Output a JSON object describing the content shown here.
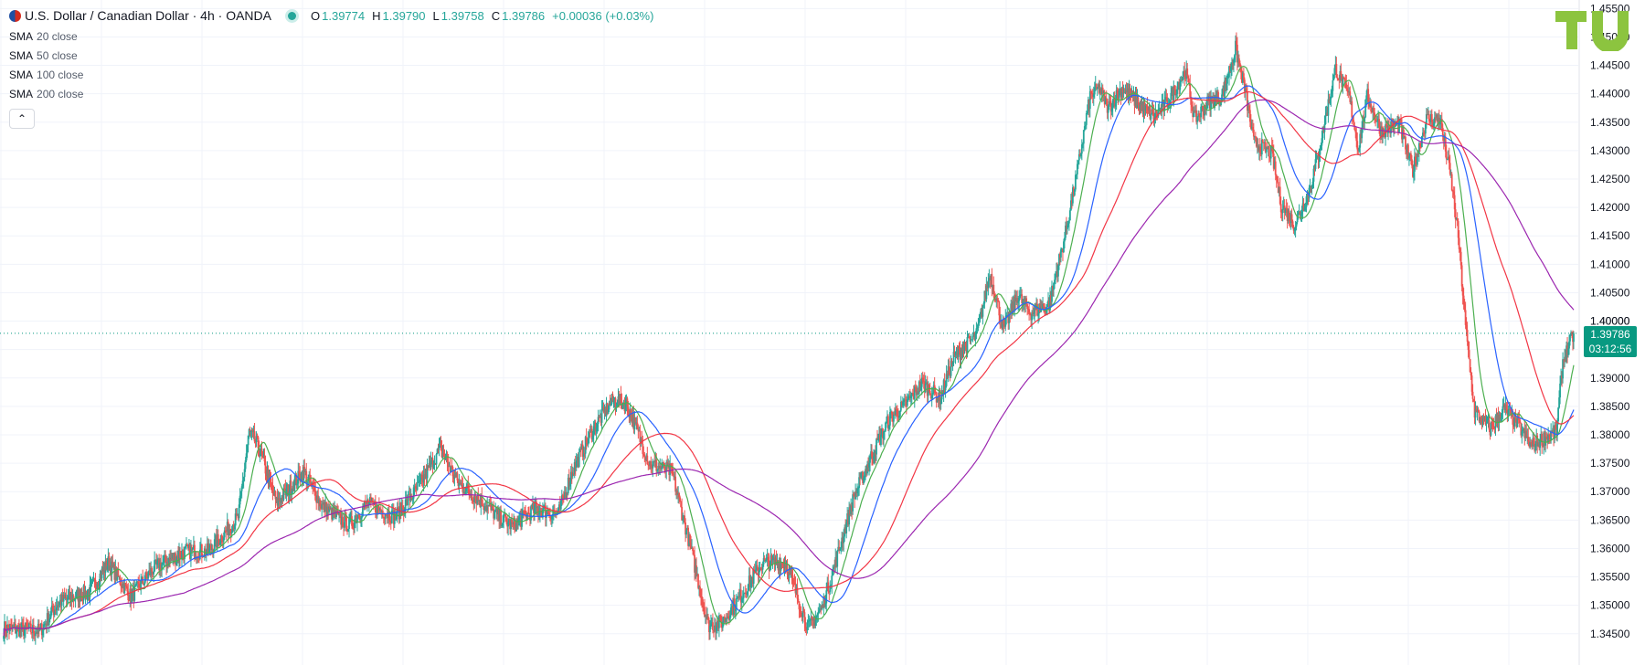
{
  "header": {
    "symbol_title": "U.S. Dollar / Canadian Dollar · 4h · OANDA",
    "ohlc": [
      {
        "key": "O",
        "value": "1.39774"
      },
      {
        "key": "H",
        "value": "1.39790"
      },
      {
        "key": "L",
        "value": "1.39758"
      },
      {
        "key": "C",
        "value": "1.39786"
      }
    ],
    "change": "+0.00036 (+0.03%)"
  },
  "indicators": [
    {
      "name": "SMA",
      "params": "20 close",
      "color": "#4caf50"
    },
    {
      "name": "SMA",
      "params": "50 close",
      "color": "#2962ff"
    },
    {
      "name": "SMA",
      "params": "100 close",
      "color": "#f23645"
    },
    {
      "name": "SMA",
      "params": "200 close",
      "color": "#9c27b0"
    }
  ],
  "last_price": {
    "price": "1.39786",
    "countdown": "03:12:56",
    "color": "#089981"
  },
  "colors": {
    "up": "#26a69a",
    "down": "#ef5350",
    "grid": "#f0f3fa",
    "axis_text": "#131722"
  },
  "chart_data": {
    "type": "candlestick",
    "title": "U.S. Dollar / Canadian Dollar · 4h · OANDA",
    "ylim": [
      1.3395,
      1.4565
    ],
    "y_ticks": [
      "1.40000",
      "1.34500",
      "1.35000",
      "1.35500",
      "1.36000",
      "1.36500",
      "1.37000",
      "1.37500",
      "1.38000",
      "1.38500",
      "1.39000",
      "1.39500",
      "1.40000",
      "1.40500",
      "1.41000",
      "1.41500",
      "1.42000",
      "1.42500",
      "1.43000",
      "1.43500",
      "1.44000",
      "1.44500",
      "1.45000",
      "1.45500"
    ],
    "grid": true,
    "last_close": 1.39786,
    "close_keypoints": [
      [
        0,
        1.346
      ],
      [
        40,
        1.3455
      ],
      [
        60,
        1.3505
      ],
      [
        95,
        1.3525
      ],
      [
        115,
        1.3575
      ],
      [
        140,
        1.3515
      ],
      [
        165,
        1.3565
      ],
      [
        200,
        1.3595
      ],
      [
        225,
        1.3595
      ],
      [
        258,
        1.3655
      ],
      [
        270,
        1.3805
      ],
      [
        280,
        1.378
      ],
      [
        300,
        1.368
      ],
      [
        330,
        1.3735
      ],
      [
        350,
        1.3675
      ],
      [
        380,
        1.364
      ],
      [
        400,
        1.368
      ],
      [
        430,
        1.3655
      ],
      [
        455,
        1.3705
      ],
      [
        480,
        1.3775
      ],
      [
        500,
        1.3715
      ],
      [
        520,
        1.369
      ],
      [
        545,
        1.3655
      ],
      [
        560,
        1.364
      ],
      [
        585,
        1.367
      ],
      [
        610,
        1.366
      ],
      [
        625,
        1.3735
      ],
      [
        650,
        1.3815
      ],
      [
        670,
        1.386
      ],
      [
        685,
        1.3855
      ],
      [
        695,
        1.3815
      ],
      [
        710,
        1.375
      ],
      [
        735,
        1.3735
      ],
      [
        755,
        1.3605
      ],
      [
        775,
        1.3465
      ],
      [
        790,
        1.347
      ],
      [
        810,
        1.3515
      ],
      [
        835,
        1.3575
      ],
      [
        860,
        1.3575
      ],
      [
        885,
        1.346
      ],
      [
        900,
        1.3495
      ],
      [
        915,
        1.3575
      ],
      [
        935,
        1.369
      ],
      [
        955,
        1.3765
      ],
      [
        975,
        1.383
      ],
      [
        990,
        1.385
      ],
      [
        1010,
        1.389
      ],
      [
        1030,
        1.3865
      ],
      [
        1045,
        1.3935
      ],
      [
        1070,
        1.3975
      ],
      [
        1085,
        1.4085
      ],
      [
        1100,
        1.3985
      ],
      [
        1115,
        1.4045
      ],
      [
        1130,
        1.4015
      ],
      [
        1150,
        1.403
      ],
      [
        1168,
        1.4155
      ],
      [
        1180,
        1.4255
      ],
      [
        1195,
        1.4395
      ],
      [
        1205,
        1.441
      ],
      [
        1215,
        1.4375
      ],
      [
        1230,
        1.441
      ],
      [
        1250,
        1.438
      ],
      [
        1265,
        1.436
      ],
      [
        1280,
        1.4385
      ],
      [
        1300,
        1.444
      ],
      [
        1310,
        1.4355
      ],
      [
        1325,
        1.4385
      ],
      [
        1340,
        1.4395
      ],
      [
        1355,
        1.448
      ],
      [
        1365,
        1.441
      ],
      [
        1375,
        1.4315
      ],
      [
        1395,
        1.4295
      ],
      [
        1405,
        1.4205
      ],
      [
        1420,
        1.417
      ],
      [
        1435,
        1.4225
      ],
      [
        1445,
        1.4285
      ],
      [
        1455,
        1.4365
      ],
      [
        1465,
        1.4445
      ],
      [
        1480,
        1.4395
      ],
      [
        1490,
        1.4305
      ],
      [
        1500,
        1.4395
      ],
      [
        1515,
        1.4335
      ],
      [
        1535,
        1.4345
      ],
      [
        1550,
        1.4265
      ],
      [
        1565,
        1.4355
      ],
      [
        1580,
        1.4355
      ],
      [
        1592,
        1.425
      ],
      [
        1600,
        1.415
      ],
      [
        1608,
        1.399
      ],
      [
        1618,
        1.384
      ],
      [
        1635,
        1.381
      ],
      [
        1650,
        1.3845
      ],
      [
        1665,
        1.382
      ],
      [
        1680,
        1.378
      ],
      [
        1695,
        1.3795
      ],
      [
        1708,
        1.3805
      ],
      [
        1715,
        1.393
      ],
      [
        1727,
        1.39786
      ]
    ],
    "moving_averages": [
      {
        "name": "SMA 20 close",
        "period": 20,
        "color": "#4caf50"
      },
      {
        "name": "SMA 50 close",
        "period": 50,
        "color": "#2962ff"
      },
      {
        "name": "SMA 100 close",
        "period": 100,
        "color": "#f23645"
      },
      {
        "name": "SMA 200 close",
        "period": 200,
        "color": "#9c27b0"
      }
    ]
  }
}
